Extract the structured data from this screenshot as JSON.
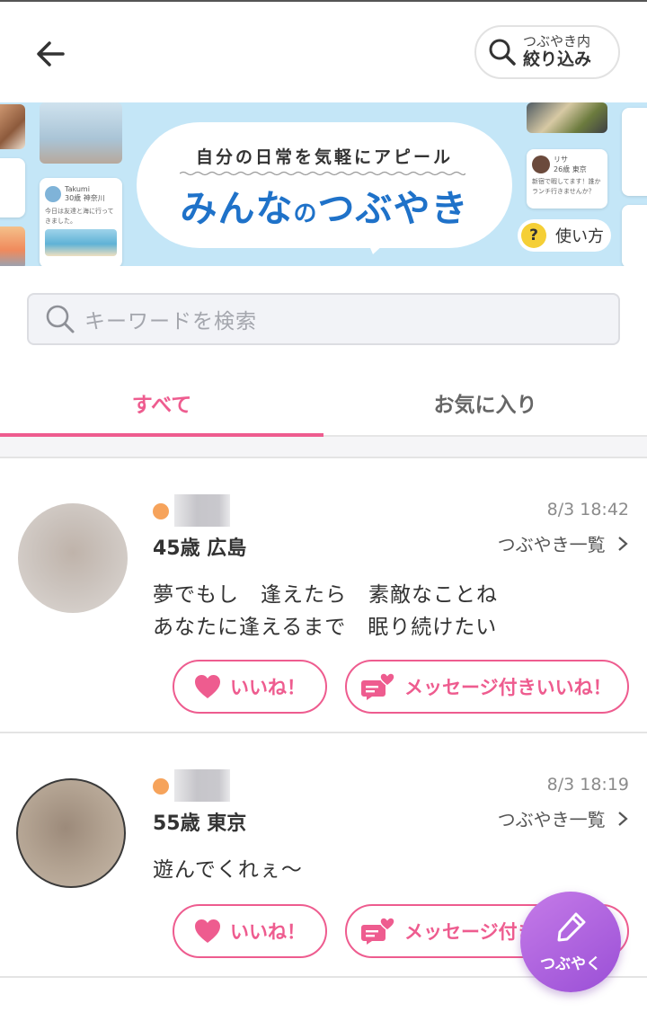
{
  "header": {
    "back_icon": "arrow-left-icon",
    "filter": {
      "line1": "つぶやき内",
      "line2": "絞り込み",
      "icon": "search-icon"
    }
  },
  "banner": {
    "subtitle": "自分の日常を気軽にアピール",
    "title_part1": "みんな",
    "title_small": "の",
    "title_part2": "つぶやき",
    "help_icon": "?",
    "help_label": "使い方",
    "card_left": {
      "name": "Takumi",
      "age_area": "30歳 神奈川",
      "text": "今日は友達と海に行ってきました。"
    },
    "card_right": {
      "name": "リサ",
      "age_area": "26歳 東京",
      "text": "新宿で暇してます！誰かランチ行きませんか？"
    }
  },
  "search": {
    "placeholder": "キーワードを検索",
    "icon": "search-icon"
  },
  "tabs": [
    {
      "label": "すべて",
      "active": true
    },
    {
      "label": "お気に入り",
      "active": false
    }
  ],
  "posts": [
    {
      "date": "8/3 18:42",
      "age_area": "45歳 広島",
      "list_link": "つぶやき一覧",
      "text": "夢でもし　逢えたら　素敵なことね\nあなたに逢えるまで　眠り続けたい",
      "like_label": "いいね！",
      "message_like_label": "メッセージ付きいいね！"
    },
    {
      "date": "8/3 18:19",
      "age_area": "55歳 東京",
      "list_link": "つぶやき一覧",
      "text": "遊んでくれぇ〜",
      "like_label": "いいね！",
      "message_like_label": "メッセージ付きいいね！"
    }
  ],
  "fab": {
    "label": "つぶやく",
    "icon": "pencil-icon"
  },
  "colors": {
    "accent": "#ee5c8f",
    "banner_bg": "#c4e6f7",
    "title_blue": "#1f72c9",
    "fab": "#a85ce0",
    "online": "#f6a35b"
  }
}
